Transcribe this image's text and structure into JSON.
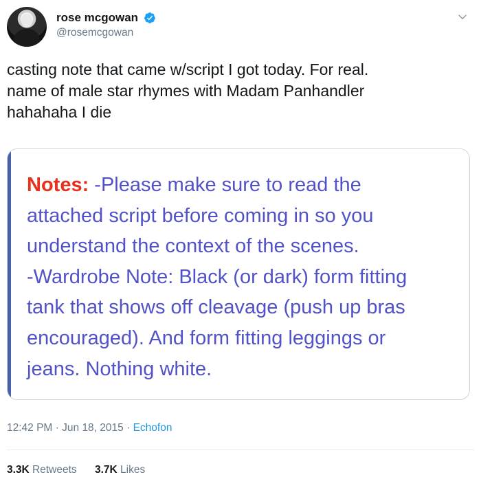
{
  "author": {
    "display_name": "rose mcgowan",
    "handle": "@rosemcgowan",
    "verified_icon": "verified-badge-icon",
    "avatar_icon": "avatar"
  },
  "menu_icon": "chevron-down-icon",
  "tweet": {
    "lines": [
      "casting note that came w/script I got today. For real.",
      "name of male star rhymes with Madam Panhandler",
      "hahahaha I die"
    ]
  },
  "image_card": {
    "notes_label": "Notes:",
    "lines": [
      " -Please make sure to read the",
      "attached script before coming in so you",
      "understand the context of the scenes.",
      "-Wardrobe Note: Black (or dark) form fitting",
      "tank that shows off cleavage (push up bras",
      "encouraged). And form fitting leggings or",
      "jeans. Nothing white."
    ],
    "label_color": "#e8311c",
    "text_color": "#5252c8"
  },
  "meta": {
    "time": "12:42 PM",
    "sep1": " · ",
    "date": "Jun 18, 2015",
    "sep2": " · ",
    "source": "Echofon"
  },
  "stats": {
    "retweets_count": "3.3K",
    "retweets_label": " Retweets",
    "likes_count": "3.7K",
    "likes_label": " Likes"
  },
  "colors": {
    "accent": "#1b95e0",
    "secondary_text": "#657786"
  }
}
